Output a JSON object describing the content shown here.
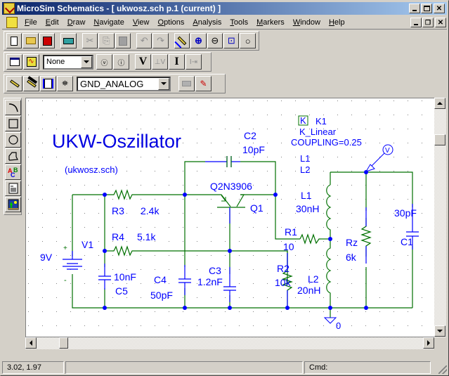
{
  "window": {
    "title": "MicroSim Schematics - [ ukwosz.sch  p.1 (current)  ]",
    "caption_buttons": [
      "minimize-icon",
      "maximize-icon",
      "close-icon"
    ],
    "mdi_buttons": [
      "minimize-icon",
      "restore-icon",
      "close-icon"
    ]
  },
  "menu": {
    "items": [
      {
        "label": "File",
        "key": "F"
      },
      {
        "label": "Edit",
        "key": "E"
      },
      {
        "label": "Draw",
        "key": "D"
      },
      {
        "label": "Navigate",
        "key": "N"
      },
      {
        "label": "View",
        "key": "V"
      },
      {
        "label": "Options",
        "key": "O"
      },
      {
        "label": "Analysis",
        "key": "A"
      },
      {
        "label": "Tools",
        "key": "T"
      },
      {
        "label": "Markers",
        "key": "M"
      },
      {
        "label": "Window",
        "key": "W"
      },
      {
        "label": "Help",
        "key": "H"
      }
    ]
  },
  "toolbar1": {
    "buttons": [
      "new-file",
      "open-file",
      "save-file",
      "print",
      "cut",
      "copy",
      "paste",
      "undo",
      "redo",
      "redraw",
      "zoom-in",
      "zoom-out",
      "zoom-area",
      "zoom-fit"
    ]
  },
  "toolbar2": {
    "buttons_left": [
      "edit-attributes",
      "setup-analysis"
    ],
    "combo_value": "None",
    "buttons_right": [
      "probe-voltage",
      "probe-current",
      "voltage-marker",
      "voltage-differential-marker",
      "current-marker",
      "current-into-pin-marker"
    ]
  },
  "toolbar3": {
    "buttons_left": [
      "draw-wire",
      "draw-bus",
      "draw-block",
      "get-part"
    ],
    "combo_value": "GND_ANALOG",
    "buttons_right": [
      "place-part-disabled",
      "edit-symbol"
    ]
  },
  "left_toolbar": {
    "buttons": [
      "arc-tool",
      "box-tool",
      "circle-tool",
      "polyline-tool",
      "text-tool",
      "text-box-tool",
      "insert-picture-tool"
    ]
  },
  "schematic": {
    "title": "UKW-Oszillator",
    "subtitle": "(ukwosz.sch)",
    "colors": {
      "wire": "#007000",
      "part": "#0000ff",
      "junction": "#0000ff",
      "title": "#0000e0"
    },
    "coupling": {
      "ref": "K1",
      "symbol": "K",
      "model": "K_Linear",
      "param": "COUPLING=0.25",
      "l1": "L1",
      "l2": "L2"
    },
    "parts": {
      "V1": {
        "ref": "V1",
        "value": "9V",
        "plus": "+",
        "minus": "-"
      },
      "R3": {
        "ref": "R3",
        "value": "2.4k"
      },
      "R4": {
        "ref": "R4",
        "value": "5.1k"
      },
      "C5": {
        "ref": "C5",
        "value": "10nF"
      },
      "C4": {
        "ref": "C4",
        "value": "50pF"
      },
      "C3": {
        "ref": "C3",
        "value": "1.2nF"
      },
      "C2": {
        "ref": "C2",
        "value": "10pF"
      },
      "Q1": {
        "ref": "Q1",
        "value": "Q2N3906"
      },
      "R2": {
        "ref": "R2",
        "value": "10k"
      },
      "R1": {
        "ref": "R1",
        "value": "10"
      },
      "L1": {
        "ref": "L1",
        "value": "30nH"
      },
      "L2": {
        "ref": "L2",
        "value": "20nH"
      },
      "Rz": {
        "ref": "Rz",
        "value": "6k"
      },
      "C1": {
        "ref": "C1",
        "value": "30pF"
      },
      "GND": {
        "label": "0"
      },
      "VMARK": {
        "label": "V"
      }
    }
  },
  "statusbar": {
    "coords": "3.02,  1.97",
    "middle": "",
    "cmd_label": "Cmd:"
  }
}
